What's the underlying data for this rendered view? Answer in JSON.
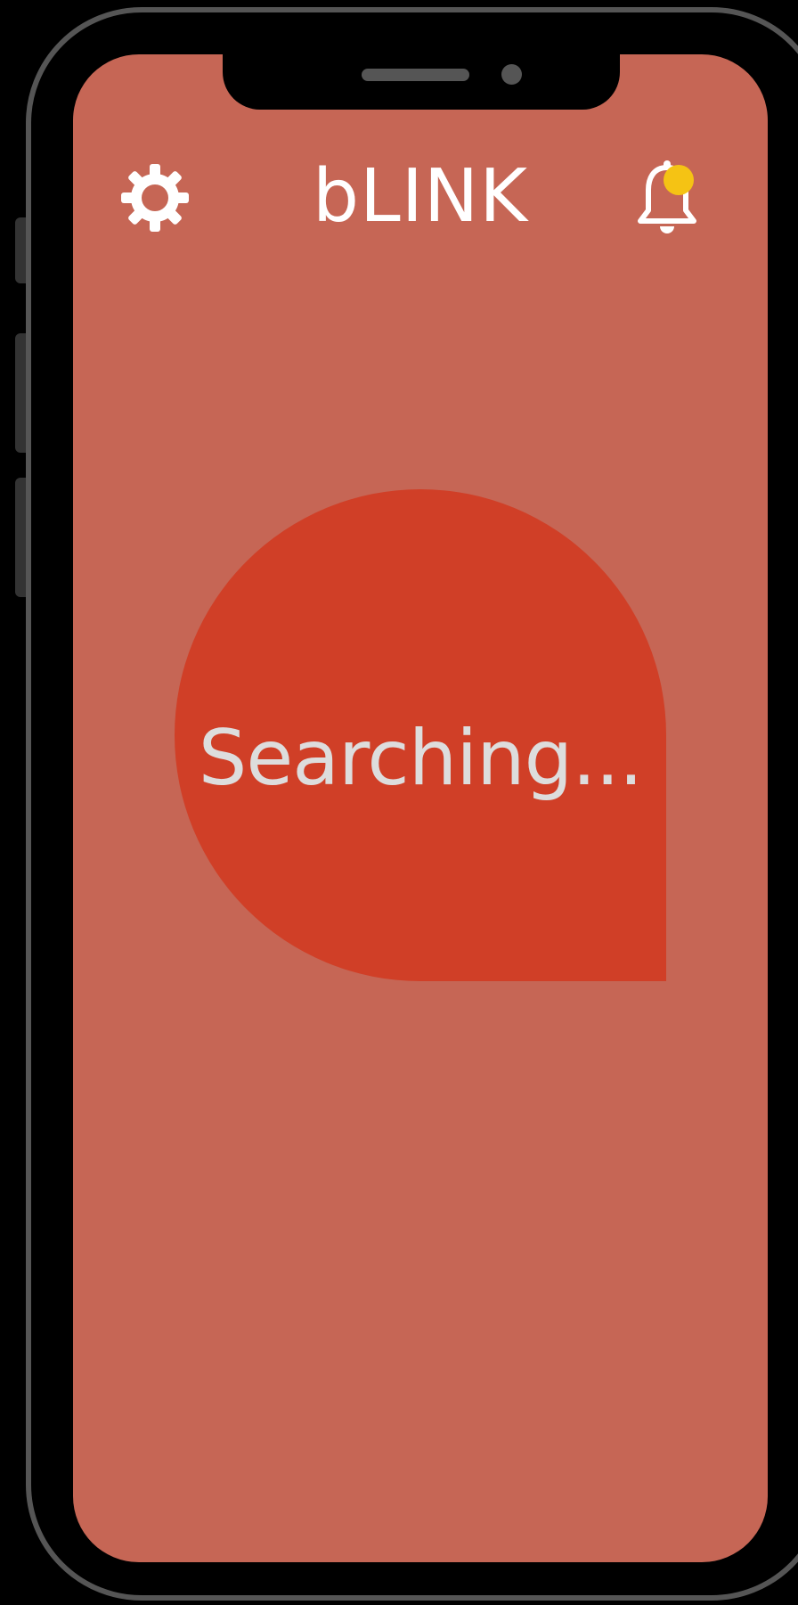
{
  "app": {
    "title": "bLINK"
  },
  "header": {
    "settings_icon": "gear-icon",
    "notifications_icon": "bell-icon",
    "has_notification": true
  },
  "main": {
    "status_text": "Searching..."
  },
  "colors": {
    "screen_background": "#c66655",
    "indicator": "#d03f27",
    "notification_dot": "#f5c314",
    "title_text": "#ffffff",
    "status_text": "#dddddd",
    "phone_bezel": "#555555"
  }
}
